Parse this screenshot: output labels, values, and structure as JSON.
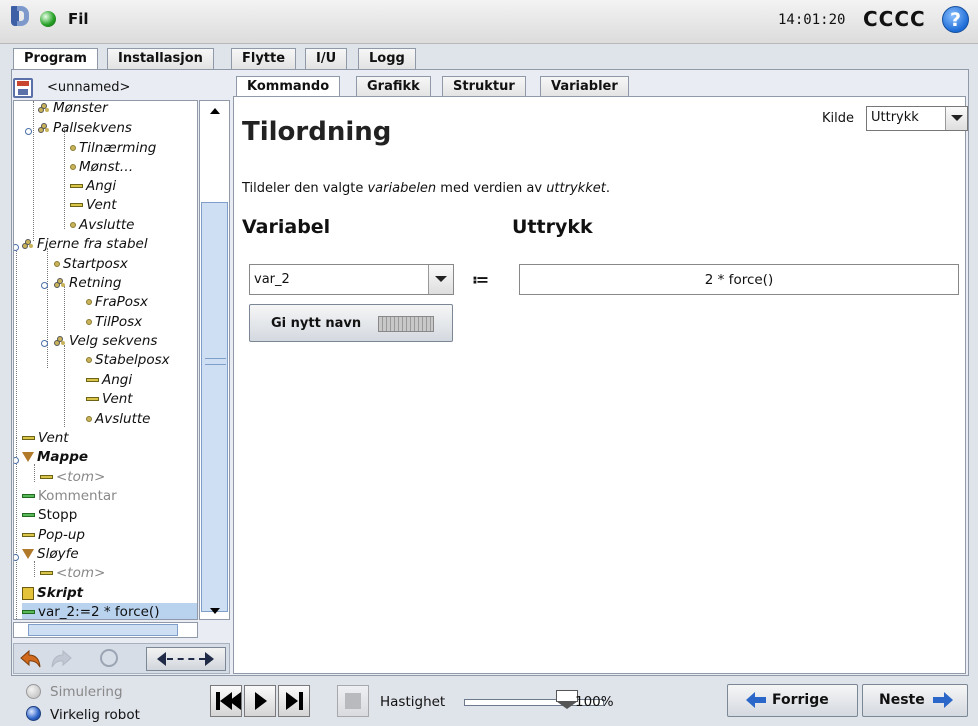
{
  "header": {
    "menu_label": "Fil",
    "time": "14:01:20",
    "robot_name": "CCCC",
    "help_label": "?"
  },
  "main_tabs": [
    {
      "label": "Program"
    },
    {
      "label": "Installasjon"
    },
    {
      "label": "Flytte"
    },
    {
      "label": "I/U"
    },
    {
      "label": "Logg"
    }
  ],
  "program": {
    "name": "<unnamed>"
  },
  "tree": [
    {
      "label": "Mønster",
      "style": "it"
    },
    {
      "label": "Pallsekvens",
      "style": "it"
    },
    {
      "label": "Tilnærming",
      "style": "it"
    },
    {
      "label": "Mønst…",
      "style": "it"
    },
    {
      "label": "Angi",
      "style": "it"
    },
    {
      "label": "Vent",
      "style": "it"
    },
    {
      "label": "Avslutte",
      "style": "it"
    },
    {
      "label": "Fjerne fra stabel",
      "style": "it"
    },
    {
      "label": "Startposx",
      "style": "it"
    },
    {
      "label": "Retning",
      "style": "it"
    },
    {
      "label": "FraPosx",
      "style": "it"
    },
    {
      "label": "TilPosx",
      "style": "it"
    },
    {
      "label": "Velg sekvens",
      "style": "it"
    },
    {
      "label": "Stabelposx",
      "style": "it"
    },
    {
      "label": "Angi",
      "style": "it"
    },
    {
      "label": "Vent",
      "style": "it"
    },
    {
      "label": "Avslutte",
      "style": "it"
    },
    {
      "label": "Vent",
      "style": "it"
    },
    {
      "label": "Mappe",
      "style": "b"
    },
    {
      "label": "<tom>",
      "style": "g"
    },
    {
      "label": "Kommentar",
      "style": "g"
    },
    {
      "label": "Stopp",
      "style": ""
    },
    {
      "label": "Pop-up",
      "style": "it"
    },
    {
      "label": "Sløyfe",
      "style": "it"
    },
    {
      "label": "<tom>",
      "style": "g"
    },
    {
      "label": "Skript",
      "style": "b"
    },
    {
      "label": "var_2:=2 * force()",
      "style": "sel"
    }
  ],
  "sub_tabs": [
    {
      "label": "Kommando"
    },
    {
      "label": "Grafikk"
    },
    {
      "label": "Struktur"
    },
    {
      "label": "Variabler"
    }
  ],
  "command": {
    "title": "Tilordning",
    "source_label": "Kilde",
    "source_value": "Uttrykk",
    "desc_a": "Tildeler den valgte ",
    "desc_b": "variabelen",
    "desc_c": " med verdien av ",
    "desc_d": "uttrykket",
    "desc_e": ".",
    "variable_heading": "Variabel",
    "expression_heading": "Uttrykk",
    "variable_value": "var_2",
    "assign_operator": "≔",
    "expression_value": "2 * force()",
    "rename_label": "Gi nytt navn"
  },
  "footer": {
    "simulation_label": "Simulering",
    "real_robot_label": "Virkelig robot",
    "speed_label": "Hastighet",
    "speed_value": "100%",
    "speed_fraction": 1.0,
    "prev_label": "Forrige",
    "next_label": "Neste"
  },
  "colors": {
    "accent": "#2a67c8",
    "selection": "#b9d3ef"
  }
}
